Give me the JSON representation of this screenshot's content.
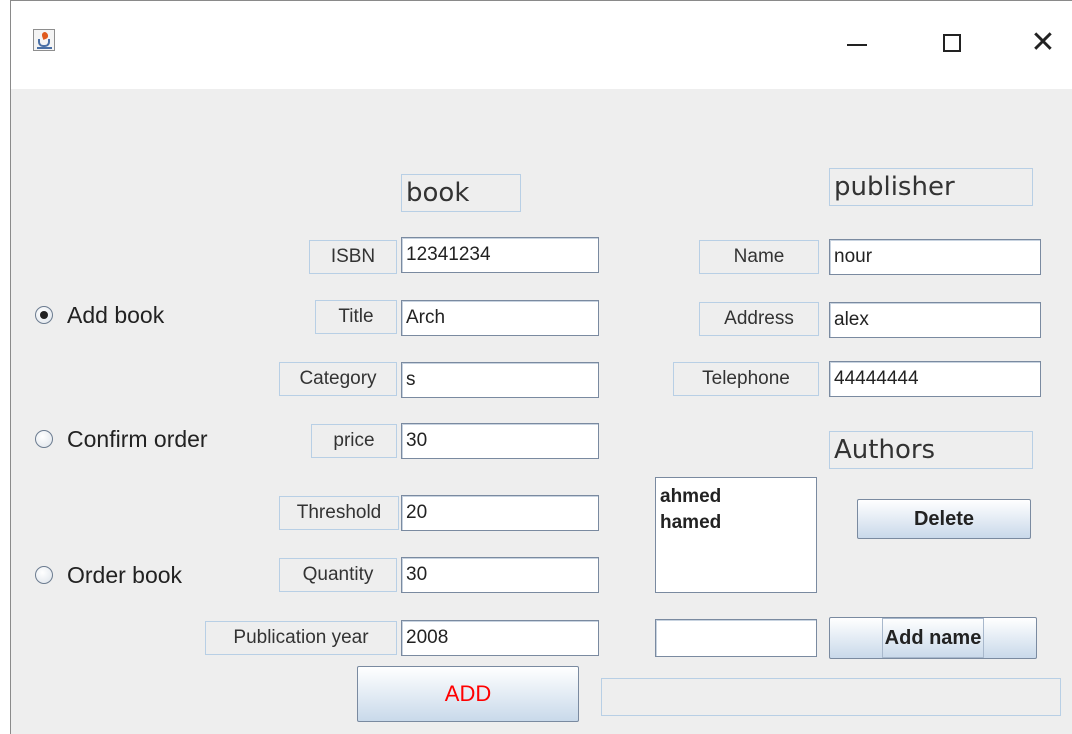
{
  "window": {
    "title": ""
  },
  "book": {
    "header": "book",
    "fields": [
      {
        "label": "ISBN",
        "value": "12341234"
      },
      {
        "label": "Title",
        "value": "Arch"
      },
      {
        "label": "Category",
        "value": "s"
      },
      {
        "label": "price",
        "value": "30"
      },
      {
        "label": "Threshold",
        "value": "20"
      },
      {
        "label": "Quantity",
        "value": "30"
      },
      {
        "label": "Publication year",
        "value": "2008"
      }
    ]
  },
  "publisher": {
    "header": "publisher",
    "fields": [
      {
        "label": "Name",
        "value": "nour"
      },
      {
        "label": "Address",
        "value": "alex"
      },
      {
        "label": "Telephone",
        "value": "44444444"
      }
    ]
  },
  "authors": {
    "header": "Authors",
    "items": [
      "ahmed",
      "hamed"
    ],
    "new_name": "",
    "delete_label": "Delete",
    "add_label": "Add name"
  },
  "modes": {
    "options": [
      "Add book",
      "Confirm order",
      "Order book"
    ],
    "selected": "Add book"
  },
  "actions": {
    "add_label": "ADD",
    "add_color": "#ff0000"
  },
  "status": {
    "text": ""
  }
}
